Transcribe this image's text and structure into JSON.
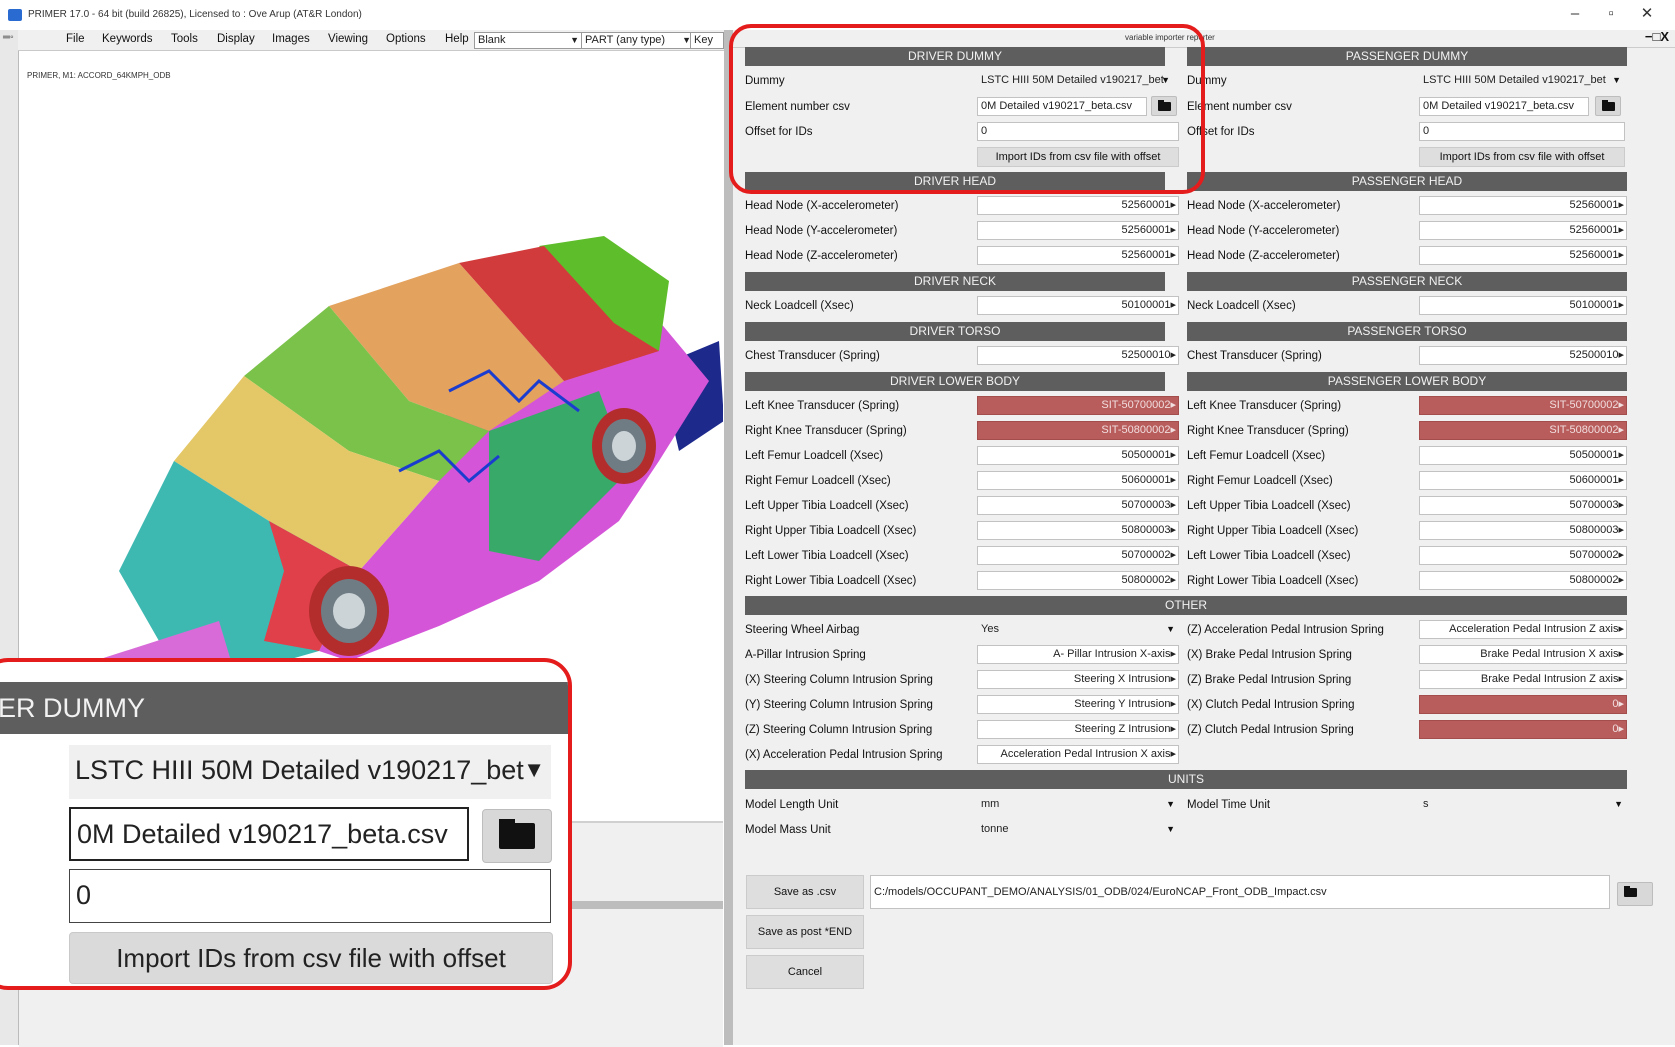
{
  "window": {
    "title": "PRIMER 17.0 - 64 bit (build 26825), Licensed to : Ove Arup (AT&R London)",
    "minimize": "–",
    "maximize": "▫",
    "close": "✕"
  },
  "menubar": {
    "items": [
      "File",
      "Keywords",
      "Tools",
      "Display",
      "Images",
      "Viewing",
      "Options",
      "Help"
    ],
    "blank_select": "Blank",
    "part_select": "PART  (any type)",
    "key_label": "Key"
  },
  "viewport": {
    "model_name": "PRIMER, M1: ACCORD_64KMPH_ODB"
  },
  "reporter": {
    "title": "variable importer reporter",
    "close_controls": "−□X",
    "driver": {
      "dummy_header": "DRIVER DUMMY",
      "dummy_label": "Dummy",
      "dummy_value": "LSTC HIII 50M Detailed v190217_bet",
      "csv_label": "Element number csv",
      "csv_value": "0M Detailed v190217_beta.csv",
      "offset_label": "Offset for IDs",
      "offset_value": "0",
      "import_button": "Import IDs from csv file with offset",
      "head_header": "DRIVER HEAD",
      "head_rows": [
        {
          "label": "Head Node (X-accelerometer)",
          "value": "52560001▸"
        },
        {
          "label": "Head Node (Y-accelerometer)",
          "value": "52560001▸"
        },
        {
          "label": "Head Node (Z-accelerometer)",
          "value": "52560001▸"
        }
      ],
      "neck_header": "DRIVER NECK",
      "neck_rows": [
        {
          "label": "Neck Loadcell (Xsec)",
          "value": "50100001▸"
        }
      ],
      "torso_header": "DRIVER TORSO",
      "torso_rows": [
        {
          "label": "Chest Transducer (Spring)",
          "value": "52500010▸"
        }
      ],
      "lower_header": "DRIVER LOWER BODY",
      "lower_rows": [
        {
          "label": "Left Knee Transducer (Spring)",
          "value": "SIT-50700002▸"
        },
        {
          "label": "Right Knee Transducer (Spring)",
          "value": "SIT-50800002▸"
        },
        {
          "label": "Left Femur Loadcell (Xsec)",
          "value": "50500001▸"
        },
        {
          "label": "Right Femur Loadcell (Xsec)",
          "value": "50600001▸"
        },
        {
          "label": "Left Upper Tibia Loadcell (Xsec)",
          "value": "50700003▸"
        },
        {
          "label": "Right Upper Tibia Loadcell (Xsec)",
          "value": "50800003▸"
        },
        {
          "label": "Left Lower Tibia Loadcell (Xsec)",
          "value": "50700002▸"
        },
        {
          "label": "Right Lower Tibia Loadcell (Xsec)",
          "value": "50800002▸"
        }
      ]
    },
    "passenger": {
      "dummy_header": "PASSENGER DUMMY",
      "dummy_label": "Dummy",
      "dummy_value": "LSTC HIII 50M Detailed v190217_bet",
      "csv_label": "Element number csv",
      "csv_value": "0M Detailed v190217_beta.csv",
      "offset_label": "Offset for IDs",
      "offset_value": "0",
      "import_button": "Import IDs from csv file with offset",
      "head_header": "PASSENGER HEAD",
      "head_rows": [
        {
          "label": "Head Node (X-accelerometer)",
          "value": "52560001▸"
        },
        {
          "label": "Head Node (Y-accelerometer)",
          "value": "52560001▸"
        },
        {
          "label": "Head Node (Z-accelerometer)",
          "value": "52560001▸"
        }
      ],
      "neck_header": "PASSENGER NECK",
      "neck_rows": [
        {
          "label": "Neck Loadcell (Xsec)",
          "value": "50100001▸"
        }
      ],
      "torso_header": "PASSENGER TORSO",
      "torso_rows": [
        {
          "label": "Chest Transducer (Spring)",
          "value": "52500010▸"
        }
      ],
      "lower_header": "PASSENGER LOWER BODY",
      "lower_rows": [
        {
          "label": "Left Knee Transducer (Spring)",
          "value": "SIT-50700002▸"
        },
        {
          "label": "Right Knee Transducer (Spring)",
          "value": "SIT-50800002▸"
        },
        {
          "label": "Left Femur Loadcell (Xsec)",
          "value": "50500001▸"
        },
        {
          "label": "Right Femur Loadcell (Xsec)",
          "value": "50600001▸"
        },
        {
          "label": "Left Upper Tibia Loadcell (Xsec)",
          "value": "50700003▸"
        },
        {
          "label": "Right Upper Tibia Loadcell (Xsec)",
          "value": "50800003▸"
        },
        {
          "label": "Left Lower Tibia Loadcell (Xsec)",
          "value": "50700002▸"
        },
        {
          "label": "Right Lower Tibia Loadcell (Xsec)",
          "value": "50800002▸"
        }
      ]
    },
    "other": {
      "header": "OTHER",
      "left_rows": [
        {
          "label": "Steering Wheel Airbag",
          "value": "Yes"
        },
        {
          "label": "A-Pillar Intrusion Spring",
          "value": "A- Pillar Intrusion X-axis▸"
        },
        {
          "label": "(X) Steering Column Intrusion Spring",
          "value": "Steering X Intrusion▸"
        },
        {
          "label": "(Y) Steering Column Intrusion Spring",
          "value": "Steering Y Intrusion▸"
        },
        {
          "label": "(Z) Steering Column Intrusion Spring",
          "value": "Steering Z Intrusion▸"
        },
        {
          "label": "(X) Acceleration Pedal Intrusion Spring",
          "value": "Acceleration Pedal  Intrusion  X axis▸"
        }
      ],
      "right_rows": [
        {
          "label": "(Z) Acceleration Pedal Intrusion Spring",
          "value": "Acceleration Pedal Intrusion Z axis▸"
        },
        {
          "label": "(X) Brake Pedal Intrusion Spring",
          "value": "Brake Pedal Intrusion  X axis▸"
        },
        {
          "label": "(Z) Brake Pedal Intrusion Spring",
          "value": "Brake Pedal Intrusion Z axis▸"
        },
        {
          "label": "(X) Clutch Pedal Intrusion Spring",
          "value": "0▸"
        },
        {
          "label": "(Z) Clutch Pedal Intrusion Spring",
          "value": "0▸"
        }
      ]
    },
    "units": {
      "header": "UNITS",
      "length_label": "Model Length Unit",
      "length_value": "mm",
      "mass_label": "Model Mass Unit",
      "mass_value": "tonne",
      "time_label": "Model Time Unit",
      "time_value": "s"
    },
    "actions": {
      "save_csv": "Save as .csv",
      "save_post_end": "Save as post *END",
      "cancel": "Cancel",
      "path": "C:/models/OCCUPANT_DEMO/ANALYSIS/01_ODB/024/EuroNCAP_Front_ODB_Impact.csv"
    }
  },
  "zoom_inset": {
    "header": "ER DUMMY",
    "dummy_value": "LSTC HIII 50M Detailed v190217_bet",
    "csv_value": "0M Detailed v190217_beta.csv",
    "offset_value": "0",
    "import_button": "Import IDs from csv file with offset"
  },
  "colors": {
    "header_bg": "#5e5e5e",
    "panel_bg": "#f0f0f0",
    "error_field": "#b85c5c",
    "highlight": "#e41c1c"
  }
}
